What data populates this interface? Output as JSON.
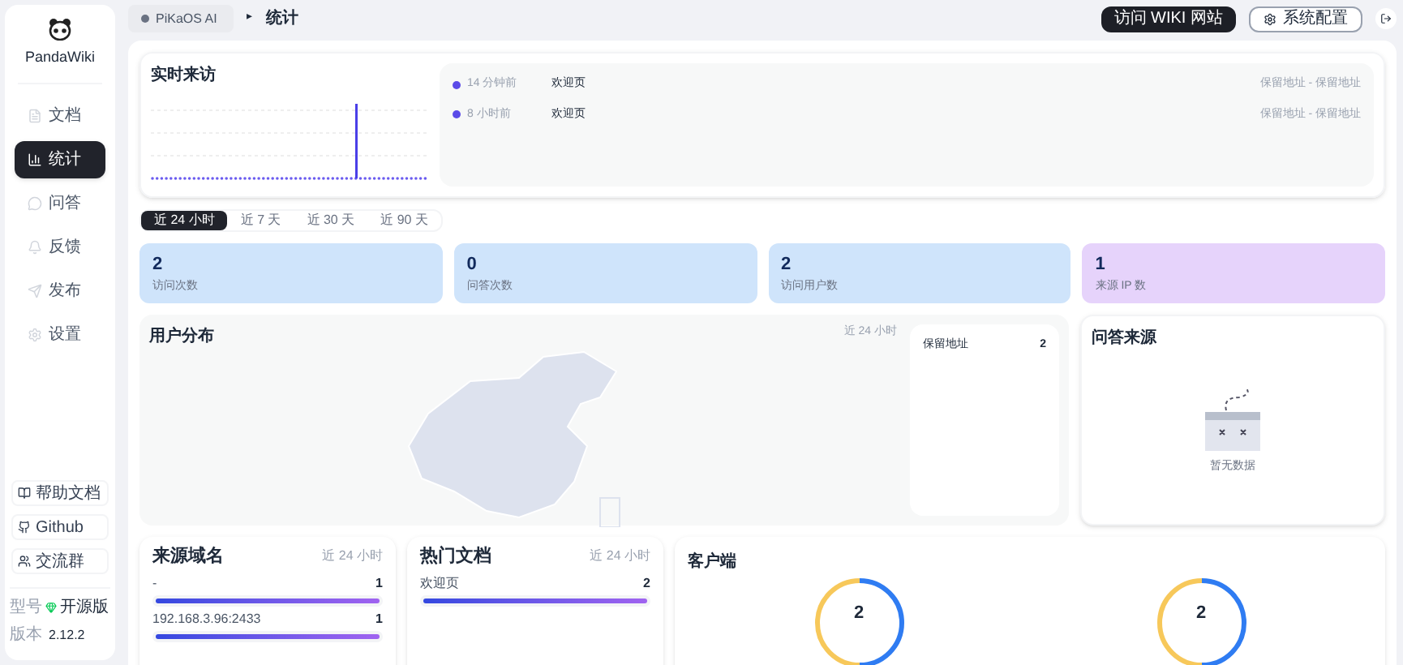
{
  "sidebar": {
    "logo_text": "PandaWiki",
    "items": [
      {
        "label": "文档",
        "selected": false
      },
      {
        "label": "统计",
        "selected": true
      },
      {
        "label": "问答",
        "selected": false
      },
      {
        "label": "反馈",
        "selected": false
      },
      {
        "label": "发布",
        "selected": false
      },
      {
        "label": "设置",
        "selected": false
      }
    ],
    "links": [
      "帮助文档",
      "Github",
      "交流群"
    ],
    "model_label": "型号",
    "model_value": "开源版",
    "version_label": "版本",
    "version_value": "2.12.2"
  },
  "breadcrumb": {
    "wiki": "PiKaOS AI",
    "separator": "▸",
    "page": "统计"
  },
  "header_buttons": [
    "访问 WIKI 网站",
    "系统配置"
  ],
  "realtime": {
    "title": "实时来访",
    "visits": [
      {
        "time": "14 分钟前",
        "page": "欢迎页",
        "location": "保留地址 - 保留地址"
      },
      {
        "time": "8 小时前",
        "page": "欢迎页",
        "location": "保留地址 - 保留地址"
      }
    ]
  },
  "range_tabs": [
    {
      "label": "近 24 小时",
      "selected": true
    },
    {
      "label": "近 7 天",
      "selected": false
    },
    {
      "label": "近 30 天",
      "selected": false
    },
    {
      "label": "近 90 天",
      "selected": false
    }
  ],
  "stats": [
    {
      "value": "2",
      "label": "访问次数",
      "color": "#cfe4fb"
    },
    {
      "value": "0",
      "label": "问答次数",
      "color": "#cfe4fb"
    },
    {
      "value": "2",
      "label": "访问用户数",
      "color": "#cfe4fb"
    },
    {
      "value": "1",
      "label": "来源 IP 数",
      "color": "#e6d3fb"
    }
  ],
  "user_distribution": {
    "title": "用户分布",
    "range": "近 24 小时",
    "regions": [
      {
        "name": "保留地址",
        "count": "2"
      }
    ]
  },
  "qa_source": {
    "title": "问答来源",
    "empty": "暂无数据"
  },
  "source_domains": {
    "title": "来源域名",
    "range": "近 24 小时",
    "rows": [
      {
        "name": "-",
        "count": "1",
        "level": 1
      },
      {
        "name": "192.168.3.96:2433",
        "count": "1",
        "level": 1
      }
    ]
  },
  "hot_docs": {
    "title": "热门文档",
    "range": "近 24 小时",
    "rows": [
      {
        "name": "欢迎页",
        "count": "2",
        "level": 1
      }
    ]
  },
  "clients": {
    "title": "客户端",
    "donuts": [
      "2",
      "2"
    ]
  }
}
